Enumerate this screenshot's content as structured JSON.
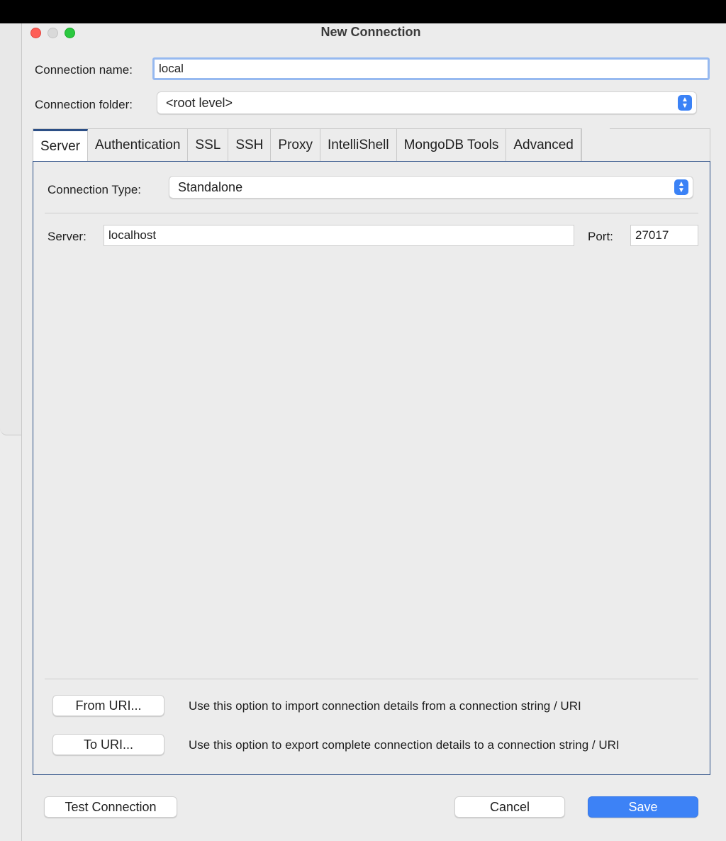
{
  "window": {
    "title": "New Connection"
  },
  "connection_name": {
    "label": "Connection name:",
    "value": "local"
  },
  "connection_folder": {
    "label": "Connection folder:",
    "value": "<root level>"
  },
  "tabs": [
    {
      "label": "Server"
    },
    {
      "label": "Authentication"
    },
    {
      "label": "SSL"
    },
    {
      "label": "SSH"
    },
    {
      "label": "Proxy"
    },
    {
      "label": "IntelliShell"
    },
    {
      "label": "MongoDB Tools"
    },
    {
      "label": "Advanced"
    }
  ],
  "server_tab": {
    "connection_type_label": "Connection Type:",
    "connection_type_value": "Standalone",
    "server_label": "Server:",
    "server_value": "localhost",
    "port_label": "Port:",
    "port_value": "27017"
  },
  "uri": {
    "from_button": "From URI...",
    "from_desc": "Use this option to import connection details from a connection string / URI",
    "to_button": "To URI...",
    "to_desc": "Use this option to export complete connection details to a connection string / URI"
  },
  "footer": {
    "test_button": "Test Connection",
    "cancel_button": "Cancel",
    "save_button": "Save"
  },
  "colors": {
    "accent": "#3d82f6",
    "tab_border": "#2c4f86"
  }
}
